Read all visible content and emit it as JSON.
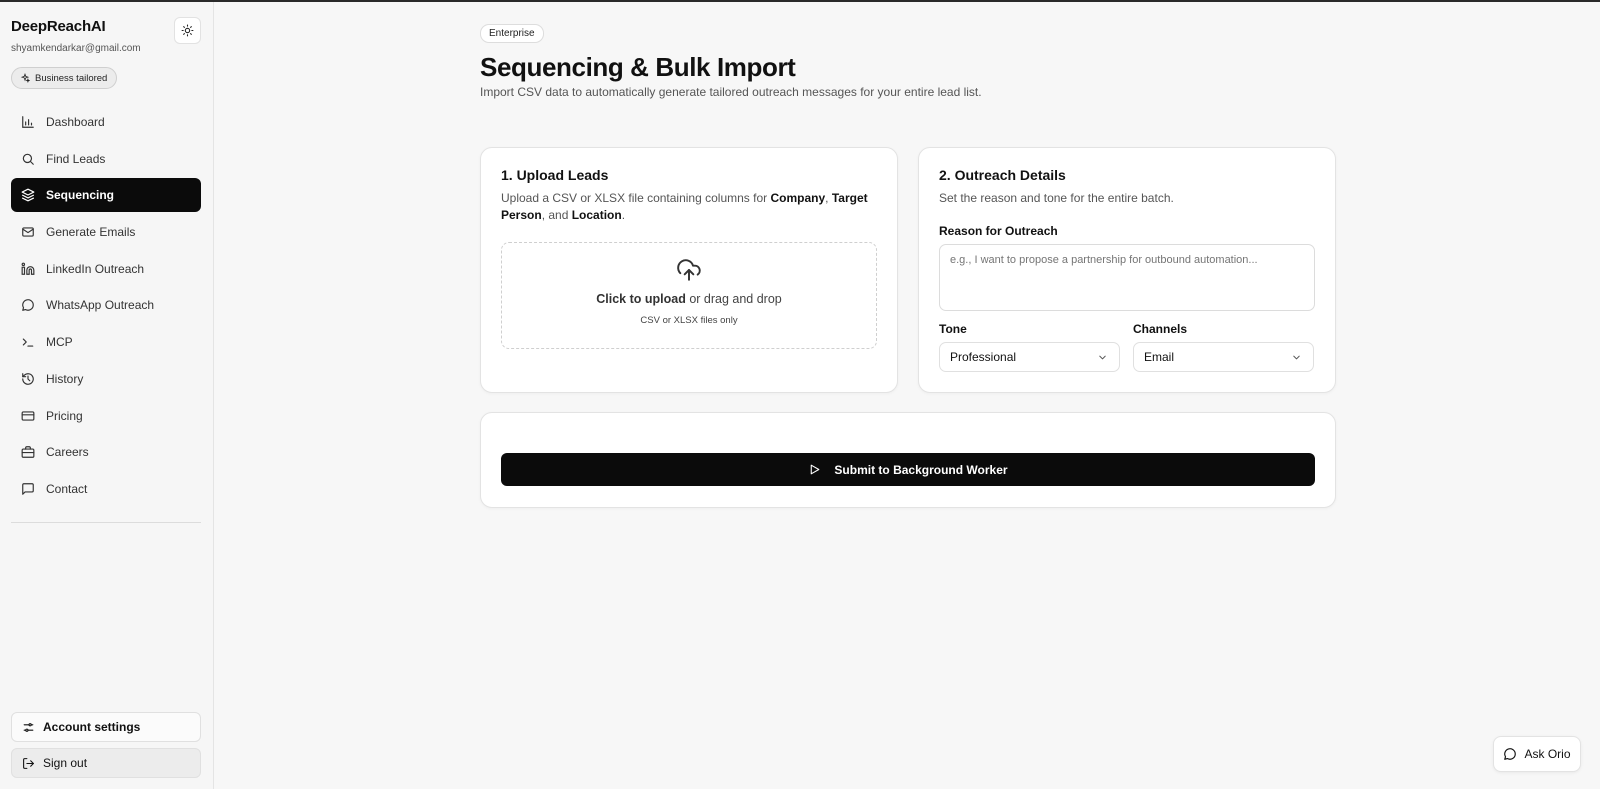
{
  "sidebar": {
    "brand": "DeepReachAI",
    "email": "shyamkendarkar@gmail.com",
    "plan_badge": "Business tailored",
    "items": [
      {
        "label": "Dashboard",
        "icon": "bar-chart-icon"
      },
      {
        "label": "Find Leads",
        "icon": "search-icon"
      },
      {
        "label": "Sequencing",
        "icon": "layers-icon",
        "active": true
      },
      {
        "label": "Generate Emails",
        "icon": "mail-icon"
      },
      {
        "label": "LinkedIn Outreach",
        "icon": "linkedin-icon"
      },
      {
        "label": "WhatsApp Outreach",
        "icon": "chat-bubble-icon"
      },
      {
        "label": "MCP",
        "icon": "terminal-icon"
      },
      {
        "label": "History",
        "icon": "history-icon"
      },
      {
        "label": "Pricing",
        "icon": "credit-card-icon"
      },
      {
        "label": "Careers",
        "icon": "briefcase-icon"
      },
      {
        "label": "Contact",
        "icon": "message-square-icon"
      }
    ],
    "account_settings": "Account settings",
    "sign_out": "Sign out"
  },
  "main": {
    "badge": "Enterprise",
    "title": "Sequencing & Bulk Import",
    "subtitle": "Import CSV data to automatically generate tailored outreach messages for your entire lead list."
  },
  "upload_card": {
    "title": "1. Upload Leads",
    "desc_prefix": "Upload a CSV or XLSX file containing columns for ",
    "col_company": "Company",
    "sep_1": ", ",
    "col_target": "Target Person",
    "sep_2": ", and ",
    "col_location": "Location",
    "desc_suffix": ".",
    "dropzone_action": "Click to upload",
    "dropzone_rest": " or drag and drop",
    "dropzone_hint": "CSV or XLSX files only"
  },
  "details_card": {
    "title": "2. Outreach Details",
    "desc": "Set the reason and tone for the entire batch.",
    "reason_label": "Reason for Outreach",
    "reason_placeholder": "e.g., I want to propose a partnership for outbound automation...",
    "tone_label": "Tone",
    "tone_value": "Professional",
    "channels_label": "Channels",
    "channels_value": "Email"
  },
  "submit": {
    "label": "Submit to Background Worker"
  },
  "assistant": {
    "label": "Ask Orio"
  }
}
